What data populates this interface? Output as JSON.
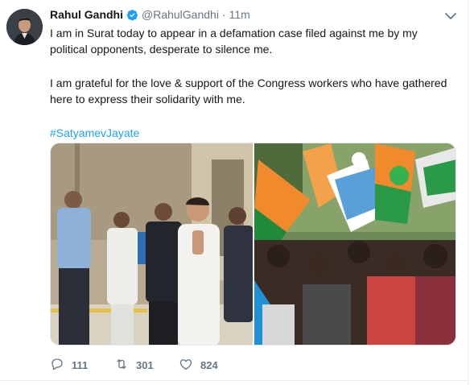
{
  "tweet": {
    "author_name": "Rahul Gandhi",
    "handle": "@RahulGandhi",
    "separator": "·",
    "time": "11m",
    "paragraph_1": "I am in Surat today to appear in a defamation case filed against me by my political opponents, desperate to silence me.",
    "paragraph_2": "I am grateful for the love & support of the Congress workers who have gathered here to express their solidarity with me.",
    "hashtag": "#SatyamevJayate"
  },
  "media": {
    "photos": [
      "walking-crowd-photo",
      "flag-waving-crowd-photo"
    ]
  },
  "actions": {
    "replies": "111",
    "retweets": "301",
    "likes": "824"
  },
  "colors": {
    "accent": "#1da1f2",
    "secondary_text": "#657786",
    "primary_text": "#14171a",
    "border": "#e6ecf0"
  },
  "icons": [
    "verified-badge-icon",
    "chevron-down-icon",
    "reply-icon",
    "retweet-icon",
    "like-icon"
  ]
}
